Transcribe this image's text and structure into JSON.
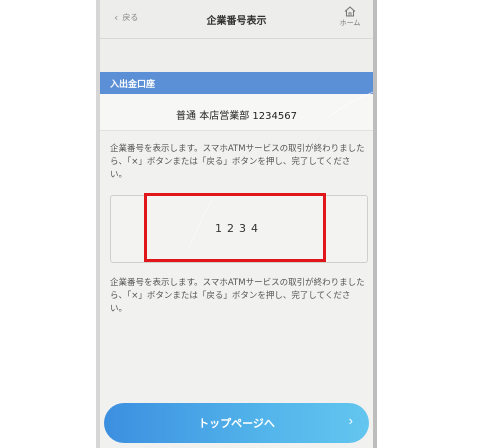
{
  "header": {
    "back_label": "戻る",
    "title": "企業番号表示",
    "home_label": "ホーム"
  },
  "section": {
    "title": "入出金口座"
  },
  "account": {
    "text": "普通  本店営業部  1234567"
  },
  "notice_top": "企業番号を表示します。スマホATMサービスの取引が終わりましたら、「×」ボタンまたは「戻る」ボタンを押し、完了してください。",
  "code": {
    "value": "1234"
  },
  "notice_bottom": "企業番号を表示します。スマホATMサービスの取引が終わりましたら、「×」ボタンまたは「戻る」ボタンを押し、完了してください。",
  "footer": {
    "top_button_label": "トップページへ"
  },
  "colors": {
    "section_band": "#5b8fd6",
    "highlight": "#e0161b",
    "button_start": "#3c8fe0",
    "button_end": "#63c6ef"
  }
}
